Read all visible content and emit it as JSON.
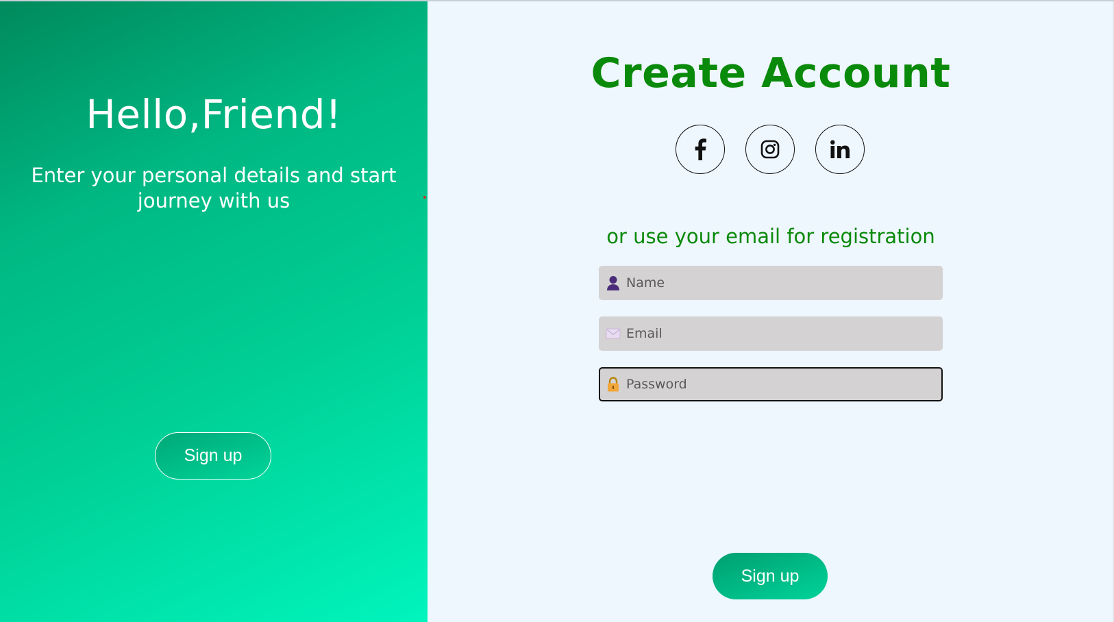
{
  "overlay": {
    "title": "Hello,Friend!",
    "subtitle": "Enter your personal details and start journey with us",
    "signup_label": "Sign up"
  },
  "form": {
    "title": "Create Account",
    "socials": [
      {
        "icon": "facebook-icon"
      },
      {
        "icon": "instagram-icon"
      },
      {
        "icon": "linkedin-icon"
      }
    ],
    "subtitle": "or use your email for registration",
    "fields": {
      "name": {
        "placeholder": "Name",
        "value": "",
        "icon": "user-icon"
      },
      "email": {
        "placeholder": "Email",
        "value": "",
        "icon": "envelope-icon"
      },
      "password": {
        "placeholder": "Password",
        "value": "",
        "icon": "lock-icon",
        "focused": true
      }
    },
    "signup_label": "Sign up"
  },
  "colors": {
    "accent_green": "#0a8a0a",
    "gradient_start": "#008a5c",
    "gradient_end": "#00f5bd",
    "form_background": "#eef6fe",
    "input_background": "#d4d2d2"
  }
}
